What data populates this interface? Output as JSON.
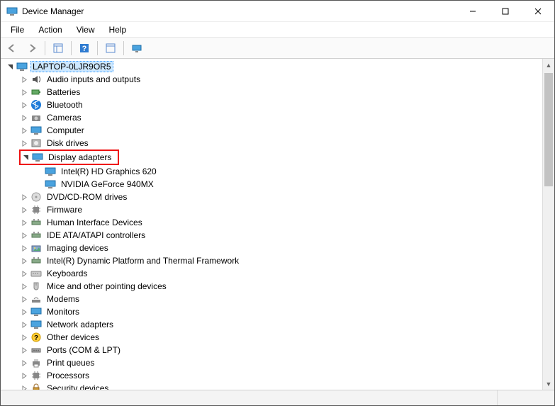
{
  "window": {
    "title": "Device Manager"
  },
  "menu": {
    "file": "File",
    "action": "Action",
    "view": "View",
    "help": "Help"
  },
  "tree": {
    "root": "LAPTOP-0LJR9OR5",
    "items": [
      {
        "label": "Audio inputs and outputs",
        "expanded": false
      },
      {
        "label": "Batteries",
        "expanded": false
      },
      {
        "label": "Bluetooth",
        "expanded": false
      },
      {
        "label": "Cameras",
        "expanded": false
      },
      {
        "label": "Computer",
        "expanded": false
      },
      {
        "label": "Disk drives",
        "expanded": false
      },
      {
        "label": "Display adapters",
        "expanded": true,
        "highlight": true,
        "children": [
          {
            "label": "Intel(R) HD Graphics 620"
          },
          {
            "label": "NVIDIA GeForce 940MX"
          }
        ]
      },
      {
        "label": "DVD/CD-ROM drives",
        "expanded": false
      },
      {
        "label": "Firmware",
        "expanded": false
      },
      {
        "label": "Human Interface Devices",
        "expanded": false
      },
      {
        "label": "IDE ATA/ATAPI controllers",
        "expanded": false
      },
      {
        "label": "Imaging devices",
        "expanded": false
      },
      {
        "label": "Intel(R) Dynamic Platform and Thermal Framework",
        "expanded": false
      },
      {
        "label": "Keyboards",
        "expanded": false
      },
      {
        "label": "Mice and other pointing devices",
        "expanded": false
      },
      {
        "label": "Modems",
        "expanded": false
      },
      {
        "label": "Monitors",
        "expanded": false
      },
      {
        "label": "Network adapters",
        "expanded": false
      },
      {
        "label": "Other devices",
        "expanded": false
      },
      {
        "label": "Ports (COM & LPT)",
        "expanded": false
      },
      {
        "label": "Print queues",
        "expanded": false
      },
      {
        "label": "Processors",
        "expanded": false
      },
      {
        "label": "Security devices",
        "expanded": false
      }
    ]
  }
}
